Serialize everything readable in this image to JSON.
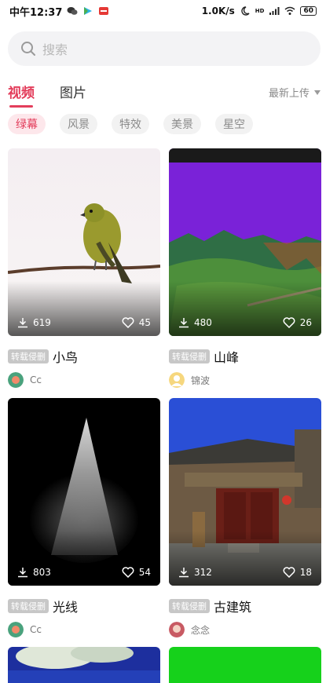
{
  "status_bar": {
    "time": "中午12:37",
    "network_speed": "1.0K/s",
    "network_type": "HD",
    "battery": "60"
  },
  "search": {
    "placeholder": "搜索"
  },
  "tabs": [
    {
      "label": "视频",
      "active": true
    },
    {
      "label": "图片",
      "active": false
    }
  ],
  "sort": {
    "label": "最新上传"
  },
  "categories": [
    {
      "label": "绿幕",
      "active": true
    },
    {
      "label": "风景",
      "active": false
    },
    {
      "label": "特效",
      "active": false
    },
    {
      "label": "美景",
      "active": false
    },
    {
      "label": "星空",
      "active": false
    }
  ],
  "cards": [
    {
      "badge": "转载侵删",
      "title": "小鸟",
      "author": "Cc",
      "downloads": "619",
      "likes": "45"
    },
    {
      "badge": "转载侵删",
      "title": "山峰",
      "author": "锦波",
      "downloads": "480",
      "likes": "26"
    },
    {
      "badge": "转载侵删",
      "title": "光线",
      "author": "Cc",
      "downloads": "803",
      "likes": "54"
    },
    {
      "badge": "转载侵删",
      "title": "古建筑",
      "author": "念念",
      "downloads": "312",
      "likes": "18"
    }
  ],
  "colors": {
    "accent": "#e33d5b"
  }
}
